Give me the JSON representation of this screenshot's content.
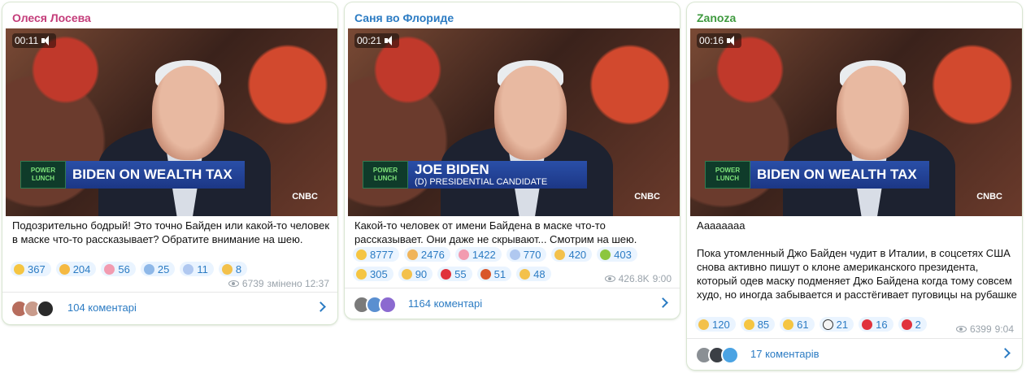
{
  "posts": [
    {
      "author": "Олеся Лосева",
      "author_color": "#c43d7a",
      "video": {
        "duration": "00:11",
        "lower_third_main": "BIDEN ON WEALTH TAX",
        "lower_third_sub": "",
        "show_label": "POWER LUNCH",
        "network": "CNBC"
      },
      "text": "Подозрительно бодрый! Это точно Байден или какой-то человек в маске что-то рассказывает? Обратите внимание на шею.",
      "reactions": [
        {
          "emoji": "thinking-face",
          "count": "367"
        },
        {
          "emoji": "rolling-laughing-face",
          "count": "204"
        },
        {
          "emoji": "pig-face",
          "count": "56"
        },
        {
          "emoji": "fearful-face",
          "count": "25"
        },
        {
          "emoji": "screaming-face",
          "count": "11"
        },
        {
          "emoji": "thumbs-up",
          "count": "8"
        }
      ],
      "views": "6739",
      "edited_time": "змінено 12:37",
      "comments": "104 коментарі"
    },
    {
      "author": "Саня во Флориде",
      "author_color": "#2b7bc3",
      "video": {
        "duration": "00:21",
        "lower_third_main": "JOE BIDEN",
        "lower_third_sub": "(D) PRESIDENTIAL CANDIDATE",
        "show_label": "POWER LUNCH",
        "network": "CNBC"
      },
      "text": "Какой-то человек от имени Байдена в маске что-то рассказывает. Они даже не скрывают... Смотрим на шею.",
      "reactions": [
        {
          "emoji": "grinning-face",
          "count": "8777"
        },
        {
          "emoji": "tired-face",
          "count": "2476"
        },
        {
          "emoji": "pig-face",
          "count": "1422"
        },
        {
          "emoji": "screaming-face",
          "count": "770"
        },
        {
          "emoji": "thumbs-up",
          "count": "420"
        },
        {
          "emoji": "money-bag",
          "count": "403"
        },
        {
          "emoji": "thinking-face",
          "count": "305"
        },
        {
          "emoji": "thumbs-down",
          "count": "90"
        },
        {
          "emoji": "red-heart",
          "count": "55"
        },
        {
          "emoji": "angry-face",
          "count": "51"
        },
        {
          "emoji": "clapping-hands",
          "count": "48"
        }
      ],
      "views": "426.8K",
      "edited_time": "9:00",
      "comments": "1164 коментарі"
    },
    {
      "author": "Zanoza",
      "author_color": "#3f9a3f",
      "video": {
        "duration": "00:16",
        "lower_third_main": "BIDEN ON WEALTH TAX",
        "lower_third_sub": "",
        "show_label": "POWER LUNCH",
        "network": "CNBC"
      },
      "text_lines": [
        "Аааааааа",
        "",
        "Пока утомленный Джо Байден чудит в Италии, в соцсетях США снова активно пишут о клоне американского президента, который одев маску подменяет Джо Байдена когда тому совсем худо, но иногда забывается и расстёгивает пуговицы на рубашке"
      ],
      "reactions": [
        {
          "emoji": "thumbs-up",
          "count": "120"
        },
        {
          "emoji": "thinking-face",
          "count": "85"
        },
        {
          "emoji": "grinning-face",
          "count": "61"
        },
        {
          "emoji": "eyes",
          "count": "21"
        },
        {
          "emoji": "hundred-points",
          "count": "16"
        },
        {
          "emoji": "red-heart",
          "count": "2"
        }
      ],
      "views": "6399",
      "edited_time": "9:04",
      "comments": "17 коментарів"
    }
  ]
}
